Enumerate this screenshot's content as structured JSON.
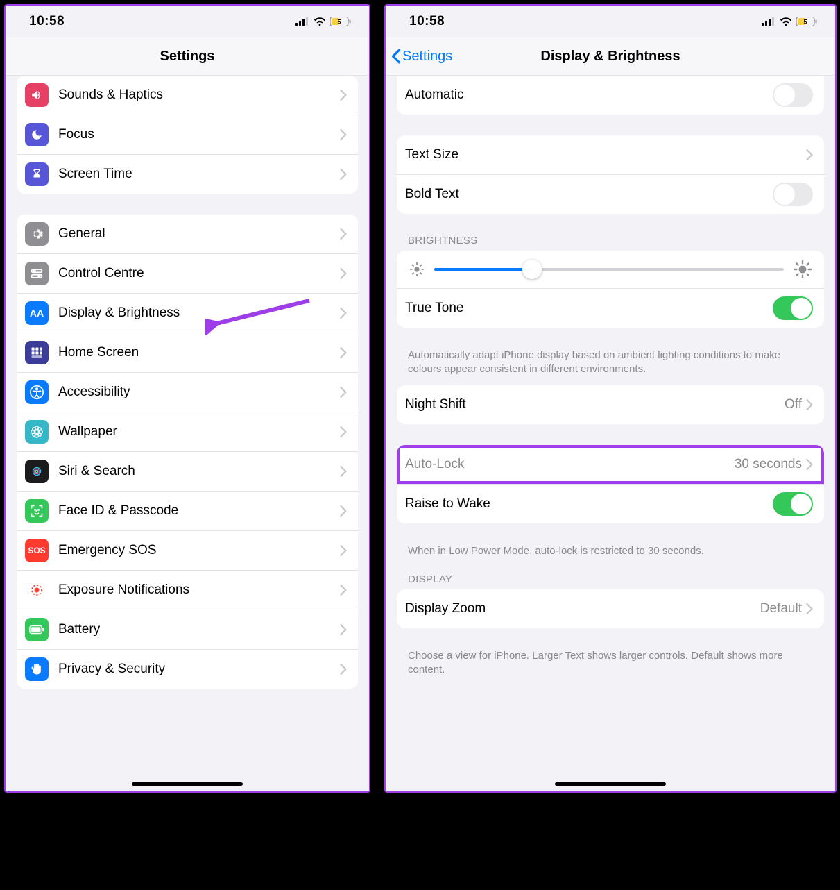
{
  "status": {
    "time": "10:58",
    "battery": "5"
  },
  "left": {
    "title": "Settings",
    "group1": [
      {
        "label": "Sounds & Haptics"
      },
      {
        "label": "Focus"
      },
      {
        "label": "Screen Time"
      }
    ],
    "group2": [
      {
        "label": "General"
      },
      {
        "label": "Control Centre"
      },
      {
        "label": "Display & Brightness"
      },
      {
        "label": "Home Screen"
      },
      {
        "label": "Accessibility"
      },
      {
        "label": "Wallpaper"
      },
      {
        "label": "Siri & Search"
      },
      {
        "label": "Face ID & Passcode"
      },
      {
        "label": "Emergency SOS"
      },
      {
        "label": "Exposure Notifications"
      },
      {
        "label": "Battery"
      },
      {
        "label": "Privacy & Security"
      }
    ]
  },
  "right": {
    "back": "Settings",
    "title": "Display & Brightness",
    "automatic": "Automatic",
    "textsize": "Text Size",
    "boldtext": "Bold Text",
    "brightness_header": "BRIGHTNESS",
    "brightness_value": 28,
    "truetone": "True Tone",
    "truetone_footer": "Automatically adapt iPhone display based on ambient lighting conditions to make colours appear consistent in different environments.",
    "nightshift": "Night Shift",
    "nightshift_value": "Off",
    "autolock": "Auto-Lock",
    "autolock_value": "30 seconds",
    "raise": "Raise to Wake",
    "raise_footer": "When in Low Power Mode, auto-lock is restricted to 30 seconds.",
    "display_header": "DISPLAY",
    "displayzoom": "Display Zoom",
    "displayzoom_value": "Default",
    "displayzoom_footer": "Choose a view for iPhone. Larger Text shows larger controls. Default shows more content."
  }
}
